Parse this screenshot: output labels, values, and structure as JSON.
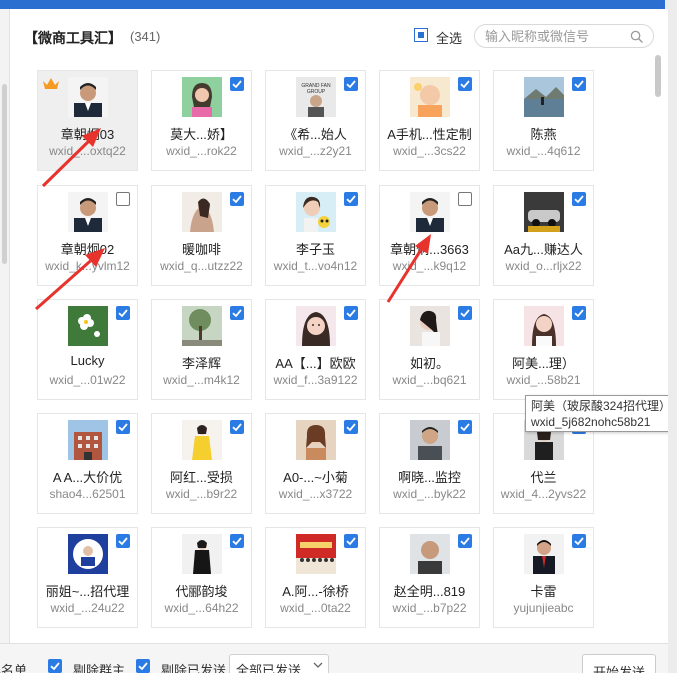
{
  "header": {
    "title": "【微商工具汇】",
    "count": "(341)",
    "select_all_label": "全选",
    "search_placeholder": "输入昵称或微信号"
  },
  "contacts": [
    {
      "name": "章朝炯03",
      "wxid": "wxid_...oxtq22",
      "checked": false,
      "crown": true,
      "highlight": true,
      "avatar": "man-suit"
    },
    {
      "name": "莫大...娇】",
      "wxid": "wxid_...rok22",
      "checked": true,
      "avatar": "woman-green"
    },
    {
      "name": "《希...始人",
      "wxid": "wxid_...z2y21",
      "checked": true,
      "avatar": "grand-fan"
    },
    {
      "name": "A手机...性定制",
      "wxid": "wxid_...3cs22",
      "checked": true,
      "avatar": "baby"
    },
    {
      "name": "陈燕",
      "wxid": "wxid_...4q612",
      "checked": true,
      "avatar": "lake"
    },
    {
      "name": "章朝炯02",
      "wxid": "wxid_k...yvlm12",
      "checked": false,
      "avatar": "man-suit"
    },
    {
      "name": "暖咖啡",
      "wxid": "wxid_q...utzz22",
      "checked": true,
      "avatar": "woman-dark"
    },
    {
      "name": "李子玉",
      "wxid": "wxid_t...vo4n12",
      "checked": true,
      "avatar": "woman-yellow"
    },
    {
      "name": "章朝炯...3663",
      "wxid": "wxid_...k9q12",
      "checked": false,
      "avatar": "man-suit"
    },
    {
      "name": "Aa九...赚达人",
      "wxid": "wxid_o...rljx22",
      "checked": true,
      "avatar": "car"
    },
    {
      "name": "Lucky",
      "wxid": "wxid_...01w22",
      "checked": true,
      "avatar": "flower"
    },
    {
      "name": "李泽辉",
      "wxid": "wxid_...m4k12",
      "checked": true,
      "avatar": "tree"
    },
    {
      "name": "AA【...】欧欧",
      "wxid": "wxid_f...3a9122",
      "checked": true,
      "avatar": "woman-face"
    },
    {
      "name": "如初。",
      "wxid": "wxid_...bq621",
      "checked": true,
      "avatar": "woman-lean"
    },
    {
      "name": "阿美...理）",
      "wxid": "wxid_...58b21",
      "checked": true,
      "avatar": "woman-pink"
    },
    {
      "name": "A A...大价优",
      "wxid": "shao4...62501",
      "checked": true,
      "avatar": "building"
    },
    {
      "name": "阿红...受损",
      "wxid": "wxid_...b9r22",
      "checked": true,
      "avatar": "woman-yellowdress"
    },
    {
      "name": "A0-...~小菊",
      "wxid": "wxid_...x3722",
      "checked": true,
      "avatar": "woman-brown"
    },
    {
      "name": "啊晓...监控",
      "wxid": "wxid_...byk22",
      "checked": true,
      "avatar": "man-gray"
    },
    {
      "name": "代兰",
      "wxid": "wxid_4...2yvs22",
      "checked": true,
      "avatar": "woman-shop"
    },
    {
      "name": "丽姐~...招代理",
      "wxid": "wxid_...24u22",
      "checked": true,
      "avatar": "badge-circle"
    },
    {
      "name": "代郦韵埈",
      "wxid": "wxid_...64h22",
      "checked": true,
      "avatar": "woman-black"
    },
    {
      "name": "A.阿...-徐桥",
      "wxid": "wxid_...0ta22",
      "checked": true,
      "avatar": "red-crowd"
    },
    {
      "name": "赵全明...819",
      "wxid": "wxid_...b7p22",
      "checked": true,
      "avatar": "man-bald"
    },
    {
      "name": "卡雷",
      "wxid": "yujunjieabc",
      "checked": true,
      "avatar": "man-tie"
    }
  ],
  "tooltip": {
    "line1": "阿美（玻尿酸324招代理）",
    "line2": "wxid_5j682nohc58b21"
  },
  "footer": {
    "blacklist_label": "黑名单",
    "exclude_owner_label": "剔除群主",
    "exclude_sent_label": "剔除已发送",
    "send_scope_value": "全部已发送",
    "start_button": "开始发送"
  },
  "colors": {
    "accent": "#2b7be5",
    "title_bar": "#2b6fd0",
    "arrow": "#e8322c"
  }
}
